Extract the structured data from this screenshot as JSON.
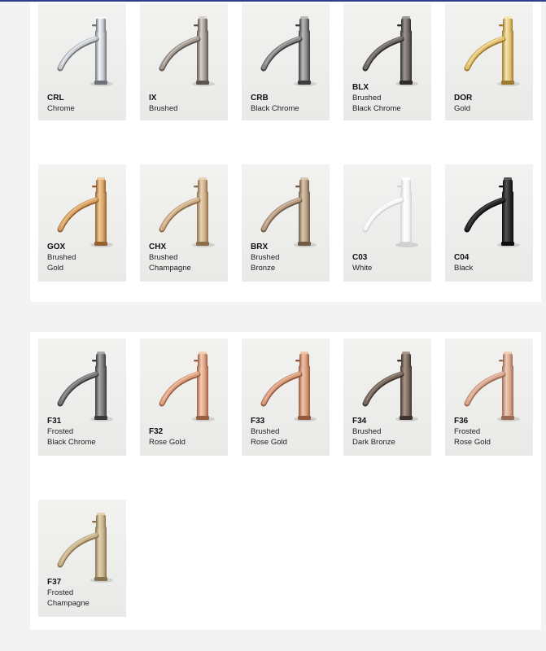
{
  "sections": [
    {
      "items": [
        {
          "code": "CRL",
          "name": "Chrome",
          "color": "#c9ccd0",
          "dark": "#6e7277",
          "light": "#f4f6f8",
          "style": "top"
        },
        {
          "code": "IX",
          "name": "Brushed",
          "color": "#a39a92",
          "dark": "#5b544f",
          "light": "#d6d0ca",
          "style": "top"
        },
        {
          "code": "CRB",
          "name": "Black Chrome",
          "color": "#8a8887",
          "dark": "#3d3c3c",
          "light": "#bdbbb9",
          "style": "top"
        },
        {
          "code": "BLX",
          "name": "Brushed\nBlack Chrome",
          "color": "#6f6a66",
          "dark": "#2f2c2a",
          "light": "#9d9792",
          "style": "top two"
        },
        {
          "code": "DOR",
          "name": "Gold",
          "color": "#e3c274",
          "dark": "#9e7a2f",
          "light": "#f7e6b3",
          "style": "top"
        },
        {
          "code": "GOX",
          "name": "Brushed\nGold",
          "color": "#d9a567",
          "dark": "#92612f",
          "light": "#f0cc9b",
          "style": "two"
        },
        {
          "code": "CHX",
          "name": "Brushed\nChampagne",
          "color": "#cfb08a",
          "dark": "#8c6d48",
          "light": "#e9d3b5",
          "style": "two"
        },
        {
          "code": "BRX",
          "name": "Brushed\nBronze",
          "color": "#b89f84",
          "dark": "#6f5a45",
          "light": "#dac6ae",
          "style": "two"
        },
        {
          "code": "C03",
          "name": "White",
          "color": "#f7f7f7",
          "dark": "#cfd2d4",
          "light": "#ffffff",
          "style": ""
        },
        {
          "code": "C04",
          "name": "Black",
          "color": "#2a2a2a",
          "dark": "#0d0d0d",
          "light": "#555555",
          "style": ""
        }
      ]
    },
    {
      "items": [
        {
          "code": "F31",
          "name": "Frosted\nBlack Chrome",
          "color": "#77777a",
          "dark": "#3a3a3c",
          "light": "#a8a8ab",
          "style": "two"
        },
        {
          "code": "F32",
          "name": "Rose Gold",
          "color": "#dea281",
          "dark": "#9a5f43",
          "light": "#f4cdb5",
          "style": ""
        },
        {
          "code": "F33",
          "name": "Brushed\nRose Gold",
          "color": "#d99c7d",
          "dark": "#93593e",
          "light": "#f0c4a9",
          "style": "two"
        },
        {
          "code": "F34",
          "name": "Brushed\nDark Bronze",
          "color": "#7b6a5e",
          "dark": "#3e332c",
          "light": "#a8968a",
          "style": "two"
        },
        {
          "code": "F36",
          "name": "Frosted\nRose Gold",
          "color": "#d9a78e",
          "dark": "#9a6b55",
          "light": "#efcdb9",
          "style": "two"
        },
        {
          "code": "F37",
          "name": "Frosted\nChampagne",
          "color": "#c9b48c",
          "dark": "#88734f",
          "light": "#e2d3b3",
          "style": "two"
        }
      ]
    }
  ]
}
